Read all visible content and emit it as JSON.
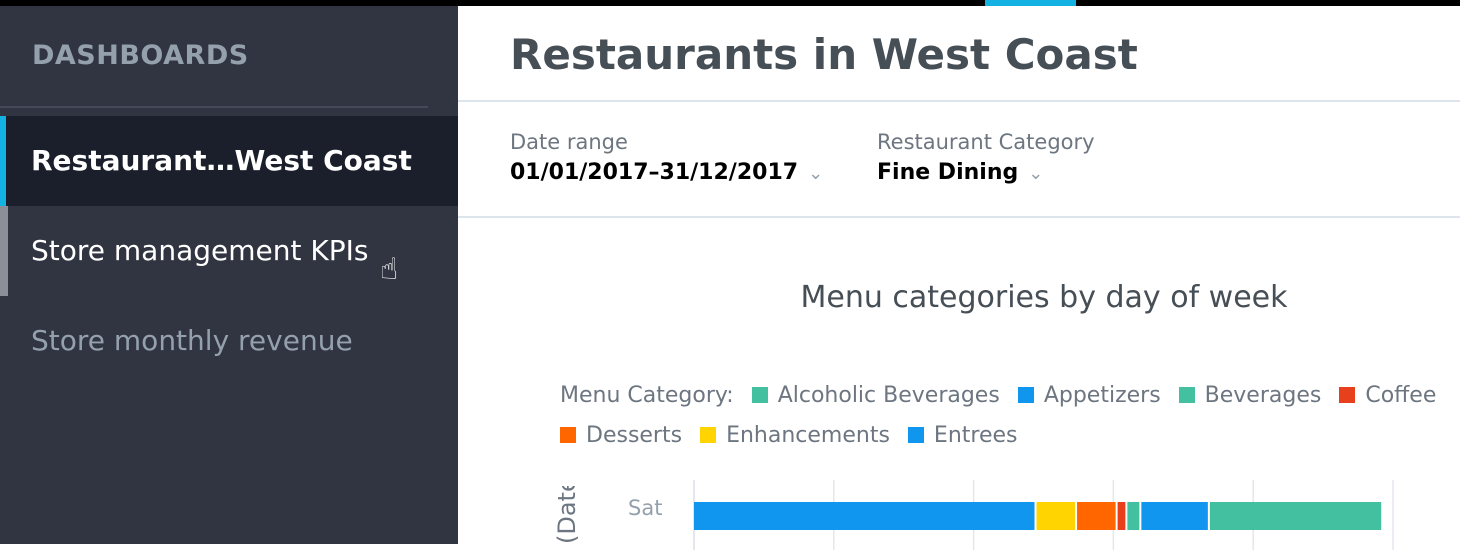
{
  "sidebar": {
    "heading": "DASHBOARDS",
    "items": [
      {
        "label": "Restaurant…West Coast",
        "state": "active"
      },
      {
        "label": "Store management KPIs",
        "state": "hover"
      },
      {
        "label": "Store monthly revenue",
        "state": "normal"
      }
    ]
  },
  "main": {
    "title": "Restaurants in West Coast",
    "filters": [
      {
        "label": "Date range",
        "value": "01/01/2017–31/12/2017"
      },
      {
        "label": "Restaurant Category",
        "value": "Fine Dining"
      }
    ]
  },
  "chart_data": {
    "type": "bar",
    "orientation": "horizontal",
    "stacked": true,
    "title": "Menu categories by day of week",
    "ylabel": "(Date)",
    "legend_title": "Menu Category:",
    "legend_placement": "top",
    "categories": [
      "Sat"
    ],
    "grid": true,
    "series": [
      {
        "name": "Alcoholic Beverages",
        "color": "#43c0a0",
        "values": [
          1.24
        ]
      },
      {
        "name": "Appetizers",
        "color": "#1196ef",
        "values": [
          0.49
        ]
      },
      {
        "name": "Beverages",
        "color": "#43c0a0",
        "values": [
          0.1
        ]
      },
      {
        "name": "Coffee",
        "color": "#e8401c",
        "values": [
          0.07
        ]
      },
      {
        "name": "Desserts",
        "color": "#ff6600",
        "values": [
          0.29
        ]
      },
      {
        "name": "Enhancements",
        "color": "#ffd400",
        "values": [
          0.29
        ]
      },
      {
        "name": "Entrees",
        "color": "#1196ef",
        "values": [
          2.45
        ]
      }
    ],
    "xlim": [
      0,
      5
    ]
  }
}
